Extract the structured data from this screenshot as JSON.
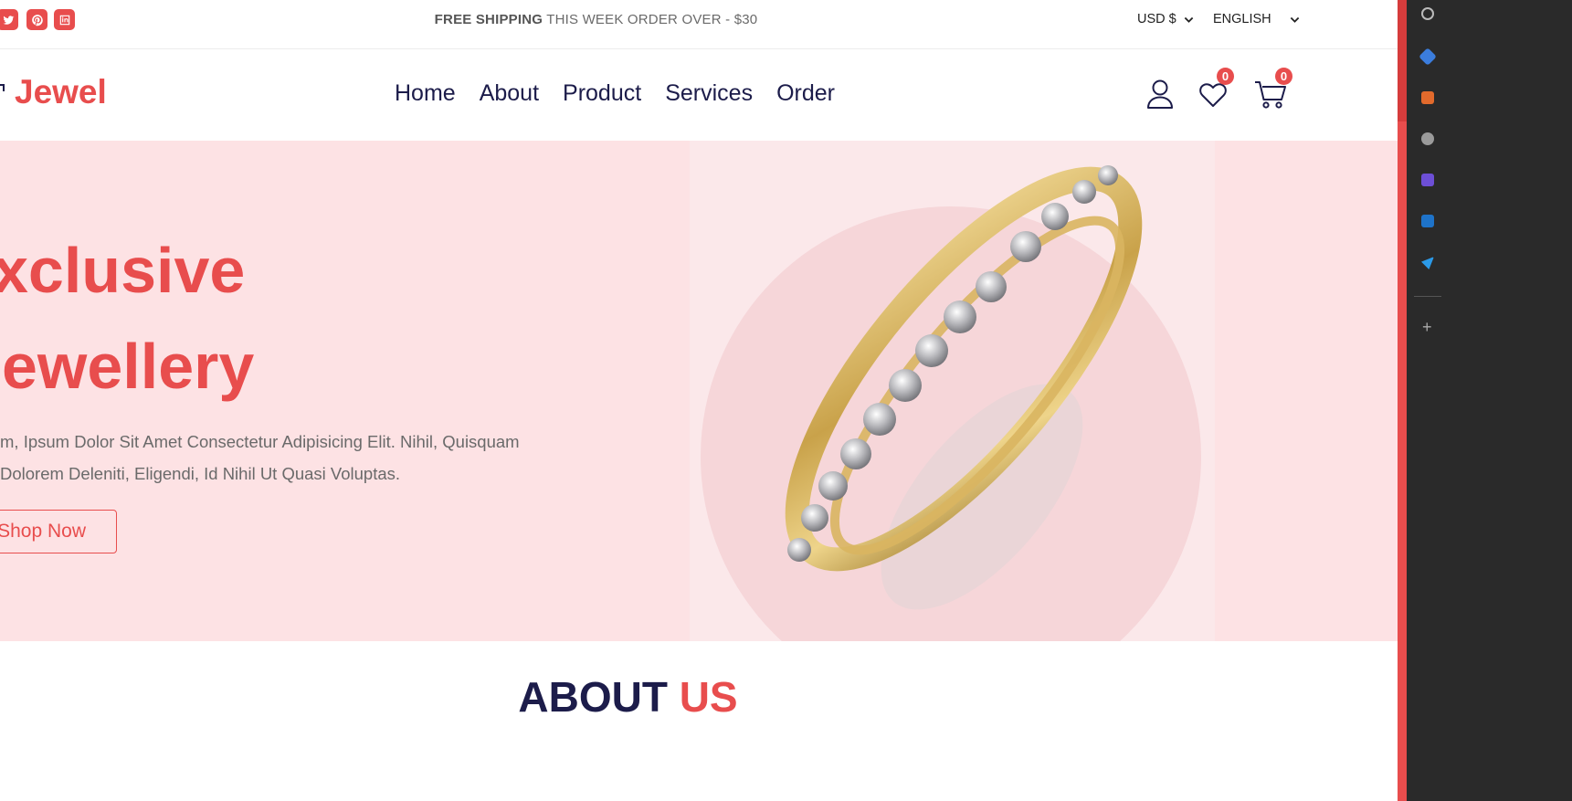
{
  "topbar": {
    "shipping_bold": "FREE SHIPPING",
    "shipping_rest": " THIS WEEK ORDER OVER - $30",
    "currency": "USD $",
    "language": "ENGLISH",
    "social_icons": [
      "twitter-icon",
      "pinterest-icon",
      "linkedin-icon"
    ]
  },
  "header": {
    "logo": "Jewel",
    "nav": [
      "Home",
      "About",
      "Product",
      "Services",
      "Order"
    ],
    "wishlist_count": "0",
    "cart_count": "0"
  },
  "hero": {
    "heading_line1": "xclusive",
    "heading_line2": "ewellery",
    "text_line1": "m, Ipsum Dolor Sit Amet Consectetur Adipisicing Elit. Nihil, Quisquam",
    "text_line2": "Dolorem Deleniti, Eligendi, Id Nihil Ut Quasi Voluptas.",
    "button": "Shop Now"
  },
  "about": {
    "title_part1": "ABOUT",
    "title_part2": "US"
  },
  "colors": {
    "accent": "#e84d4d",
    "navy": "#1c1c4a",
    "hero_bg": "#fde2e4"
  }
}
